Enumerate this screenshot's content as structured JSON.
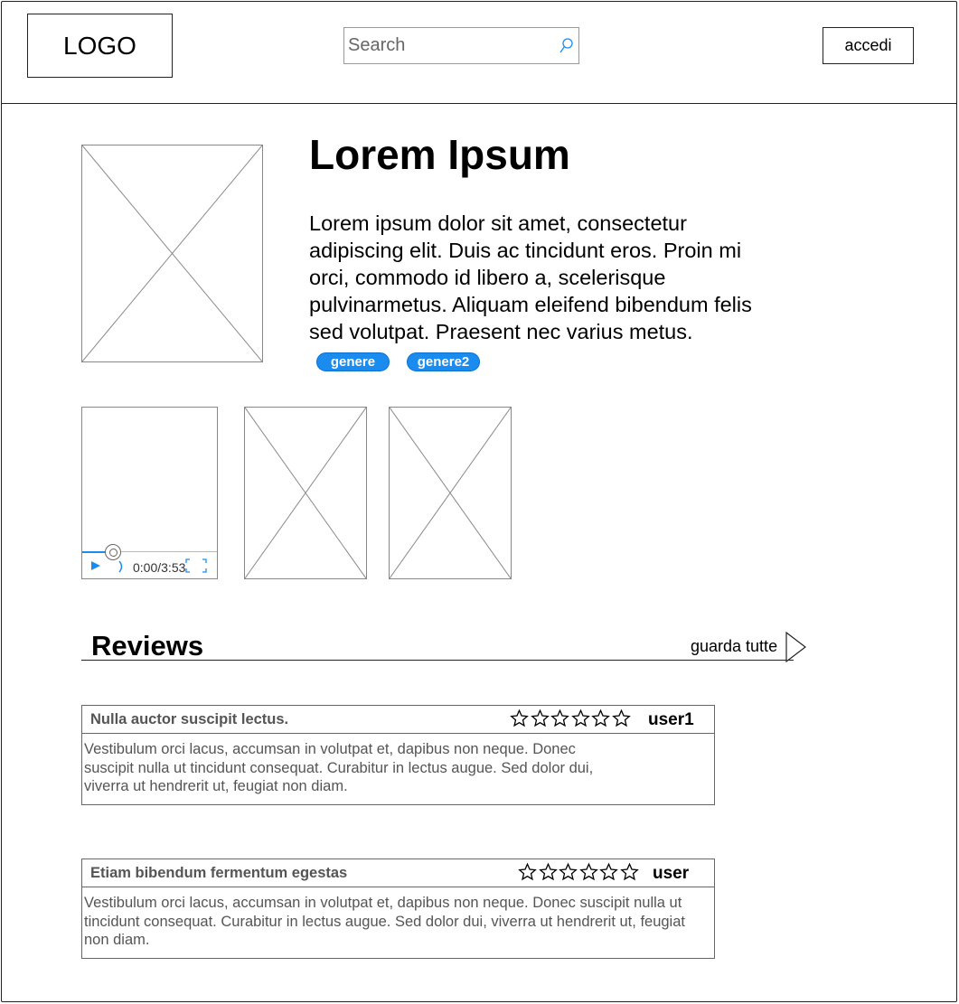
{
  "header": {
    "logo": "LOGO",
    "search_placeholder": "Search",
    "login_label": "accedi"
  },
  "main": {
    "title": "Lorem Ipsum",
    "description": "Lorem ipsum dolor sit amet, consectetur adipiscing elit. Duis ac tincidunt eros. Proin mi orci, commodo id libero a, scelerisque pulvinarmetus. Aliquam eleifend bibendum felis sed volutpat. Praesent nec varius metus.",
    "genres": [
      "genere",
      "genere2"
    ]
  },
  "media": {
    "video_time": "0:00/3:53"
  },
  "reviews": {
    "title": "Reviews",
    "see_all": "guarda tutte",
    "items": [
      {
        "title": "Nulla auctor suscipit lectus.",
        "rating": 0,
        "max_rating": 6,
        "user": "user1",
        "body": "Vestibulum orci lacus, accumsan in volutpat et, dapibus non neque. Donec suscipit nulla ut tincidunt consequat. Curabitur in lectus augue. Sed dolor dui, viverra ut hendrerit ut, feugiat non diam."
      },
      {
        "title": "Etiam bibendum fermentum egestas",
        "rating": 0,
        "max_rating": 6,
        "user": "user",
        "body": "Vestibulum orci lacus, accumsan in volutpat et, dapibus non neque. Donec suscipit nulla ut tincidunt consequat. Curabitur in lectus augue. Sed dolor dui, viverra ut hendrerit ut, feugiat non diam."
      }
    ]
  },
  "colors": {
    "accent": "#1a8cf0",
    "border": "#222222",
    "muted_text": "#555555"
  },
  "icons": {
    "search": "search-icon",
    "play": "play-icon",
    "volume": "volume-icon",
    "fullscreen": "fullscreen-icon",
    "arrow": "arrow-right-icon",
    "star": "star-icon"
  }
}
